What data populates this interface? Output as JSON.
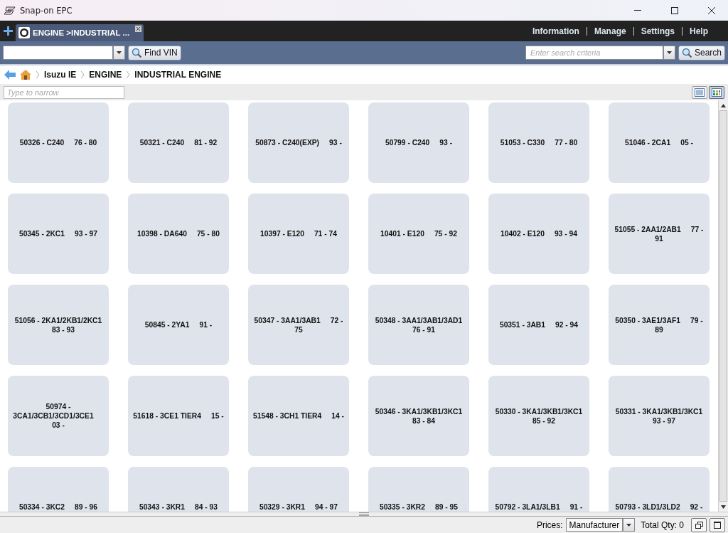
{
  "window": {
    "title": "Snap-on EPC"
  },
  "tabs": [
    {
      "label": "ENGINE >INDUSTRIAL ...",
      "selected": true
    }
  ],
  "top_menu": [
    "Information",
    "Manage",
    "Settings",
    "Help"
  ],
  "toolbar": {
    "vin_button": "Find VIN",
    "search_placeholder": "Enter search criteria",
    "search_button": "Search"
  },
  "breadcrumb": [
    "Isuzu IE",
    "ENGINE",
    "INDUSTRIAL ENGINE"
  ],
  "filter": {
    "placeholder": "Type to narrow"
  },
  "view_modes": [
    {
      "kind": "list",
      "selected": false
    },
    {
      "kind": "grid",
      "selected": true
    }
  ],
  "tiles": [
    {
      "name": "50326 - C240",
      "years": "76 - 80"
    },
    {
      "name": "50321 - C240",
      "years": "81 - 92"
    },
    {
      "name": "50873 - C240(EXP)",
      "years": "93 -"
    },
    {
      "name": "50799 - C240",
      "years": "93 -"
    },
    {
      "name": "51053 - C330",
      "years": "77 - 80"
    },
    {
      "name": "51046 - 2CA1",
      "years": "05 -"
    },
    {
      "name": "50345 - 2KC1",
      "years": "93 - 97"
    },
    {
      "name": "10398 - DA640",
      "years": "75 - 80"
    },
    {
      "name": "10397 - E120",
      "years": "71 - 74"
    },
    {
      "name": "10401 - E120",
      "years": "75 - 92"
    },
    {
      "name": "10402 - E120",
      "years": "93 - 94"
    },
    {
      "name": "51055 - 2AA1/2AB1",
      "years": "77 - 91"
    },
    {
      "name": "51056 - 2KA1/2KB1/2KC1",
      "years": "83 - 93"
    },
    {
      "name": "50845 - 2YA1",
      "years": "91 -"
    },
    {
      "name": "50347 - 3AA1/3AB1",
      "years": "72 - 75"
    },
    {
      "name": "50348 - 3AA1/3AB1/3AD1",
      "years": "76 - 91"
    },
    {
      "name": "50351 - 3AB1",
      "years": "92 - 94"
    },
    {
      "name": "50350 - 3AE1/3AF1",
      "years": "79 - 89"
    },
    {
      "name": "50974 - 3CA1/3CB1/3CD1/3CE1",
      "years": "03 -"
    },
    {
      "name": "51618 - 3CE1 TIER4",
      "years": "15 -"
    },
    {
      "name": "51548 - 3CH1 TIER4",
      "years": "14 -"
    },
    {
      "name": "50346 - 3KA1/3KB1/3KC1",
      "years": "83 - 84"
    },
    {
      "name": "50330 - 3KA1/3KB1/3KC1",
      "years": "85 - 92"
    },
    {
      "name": "50331 - 3KA1/3KB1/3KC1",
      "years": "93 - 97"
    },
    {
      "name": "50334 - 3KC2",
      "years": "89 - 96"
    },
    {
      "name": "50343 - 3KR1",
      "years": "84 - 93"
    },
    {
      "name": "50329 - 3KR1",
      "years": "94 - 97"
    },
    {
      "name": "50335 - 3KR2",
      "years": "89 - 95"
    },
    {
      "name": "50792 - 3LA1/3LB1",
      "years": "91 -"
    },
    {
      "name": "50793 - 3LD1/3LD2",
      "years": "92 -"
    }
  ],
  "status_bar": {
    "prices_label": "Prices:",
    "prices_value": "Manufacturer",
    "total_qty": "Total Qty: 0"
  }
}
